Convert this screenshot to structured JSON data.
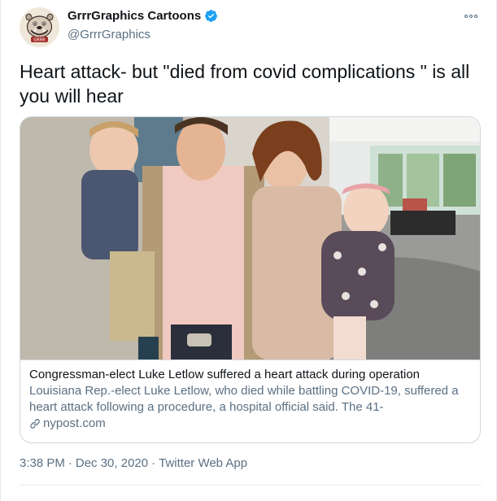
{
  "author": {
    "display_name": "GrrrGraphics Cartoons",
    "handle": "@GrrrGraphics",
    "verified": true,
    "avatar_text": "GRRR"
  },
  "tweet": {
    "text": "Heart attack- but \"died from covid complications \" is all you will hear"
  },
  "card": {
    "title": "Congressman-elect Luke Letlow suffered a heart attack during operation",
    "description": "Louisiana Rep.-elect Luke Letlow, who died while battling COVID-19, suffered a heart attack following a procedure, a hospital official said. The 41-",
    "domain": "nypost.com"
  },
  "meta": {
    "time": "3:38 PM",
    "sep1": "·",
    "date": "Dec 30, 2020",
    "sep2": "·",
    "source": "Twitter Web App"
  },
  "colors": {
    "verified": "#1da1f2",
    "secondary_text": "#5b7083",
    "primary_text": "#0f1419",
    "border": "#cfd9de"
  }
}
